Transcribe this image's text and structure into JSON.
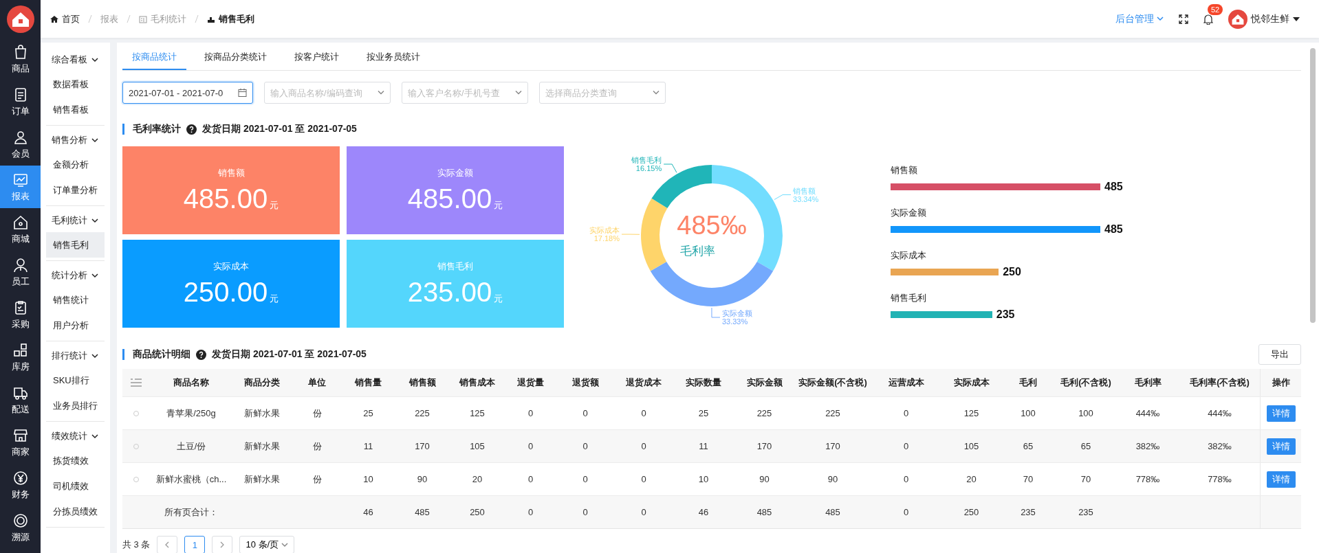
{
  "top_bar": {
    "breadcrumb": [
      {
        "label": "首页",
        "kind": "home"
      },
      {
        "label": "报表",
        "kind": "plain"
      },
      {
        "label": "毛利统计",
        "kind": "doc"
      },
      {
        "label": "销售毛利",
        "kind": "current"
      }
    ],
    "menu": "后台管理",
    "notifications": "52",
    "user": "悦邻生鲜"
  },
  "rail": [
    {
      "label": "商品",
      "selected": false
    },
    {
      "label": "订单",
      "selected": false
    },
    {
      "label": "会员",
      "selected": false
    },
    {
      "label": "报表",
      "selected": true
    },
    {
      "label": "商城",
      "selected": false
    },
    {
      "label": "员工",
      "selected": false
    },
    {
      "label": "采购",
      "selected": false
    },
    {
      "label": "库房",
      "selected": false
    },
    {
      "label": "配送",
      "selected": false
    },
    {
      "label": "商家",
      "selected": false
    },
    {
      "label": "财务",
      "selected": false
    },
    {
      "label": "溯源",
      "selected": false
    }
  ],
  "submenu": [
    {
      "label": "综合看板",
      "expanded": true,
      "items": [
        {
          "label": "数据看板",
          "selected": false
        },
        {
          "label": "销售看板",
          "selected": false
        }
      ]
    },
    {
      "label": "销售分析",
      "expanded": true,
      "items": [
        {
          "label": "金额分析",
          "selected": false
        },
        {
          "label": "订单量分析",
          "selected": false
        }
      ]
    },
    {
      "label": "毛利统计",
      "expanded": true,
      "items": [
        {
          "label": "销售毛利",
          "selected": true
        }
      ]
    },
    {
      "label": "统计分析",
      "expanded": true,
      "items": [
        {
          "label": "销售统计",
          "selected": false
        },
        {
          "label": "用户分析",
          "selected": false
        }
      ]
    },
    {
      "label": "排行统计",
      "expanded": true,
      "items": [
        {
          "label": "SKU排行",
          "selected": false
        },
        {
          "label": "业务员排行",
          "selected": false
        }
      ]
    },
    {
      "label": "绩效统计",
      "expanded": true,
      "items": [
        {
          "label": "拣货绩效",
          "selected": false
        },
        {
          "label": "司机绩效",
          "selected": false
        },
        {
          "label": "分拣员绩效",
          "selected": false
        }
      ]
    }
  ],
  "tabs": [
    {
      "label": "按商品统计",
      "selected": true
    },
    {
      "label": "按商品分类统计",
      "selected": false
    },
    {
      "label": "按客户统计",
      "selected": false
    },
    {
      "label": "按业务员统计",
      "selected": false
    }
  ],
  "filters": {
    "date_range": {
      "value": "2021-07-01 - 2021-07-0"
    },
    "selects": [
      {
        "placeholder": "输入商品名称/编码查询"
      },
      {
        "placeholder": "输入客户名称/手机号查"
      },
      {
        "placeholder": "选择商品分类查询"
      }
    ]
  },
  "summary": {
    "title": "毛利率统计",
    "subtitle": "发货日期 2021-07-01 至 2021-07-05",
    "cards": [
      {
        "label": "销售额",
        "value": "485.00",
        "unit": "元",
        "color": "#fd8367"
      },
      {
        "label": "实际金额",
        "value": "485.00",
        "unit": "元",
        "color": "#9d87fb"
      },
      {
        "label": "实际成本",
        "value": "250.00",
        "unit": "元",
        "color": "#0a9cff"
      },
      {
        "label": "销售毛利",
        "value": "235.00",
        "unit": "元",
        "color": "#54d6fc"
      }
    ],
    "center_value": "485‰",
    "center_label": "毛利率",
    "donut": {
      "chart_data": {
        "type": "donut",
        "categories": [
          "销售额",
          "实际金额",
          "实际成本",
          "销售毛利"
        ],
        "values": [
          33.34,
          33.33,
          17.18,
          16.15
        ],
        "colors": [
          "#72ddfe",
          "#74a9fd",
          "#fed46a",
          "#20b5b8"
        ],
        "annotations": [
          {
            "text": "33.34%"
          },
          {
            "text": "33.33%"
          },
          {
            "text": "17.18%"
          },
          {
            "text": "16.15%"
          }
        ]
      }
    },
    "bars": {
      "chart_data": {
        "type": "bar",
        "orientation": "horizontal",
        "categories": [
          "销售额",
          "实际金额",
          "实际成本",
          "销售毛利"
        ],
        "values": [
          485,
          485,
          250,
          235
        ],
        "colors": [
          "#d64f66",
          "#1296fb",
          "#e9a552",
          "#21b3b4"
        ],
        "data_labels": true
      }
    }
  },
  "detail": {
    "title": "商品统计明细",
    "subtitle": "发货日期 2021-07-01 至 2021-07-05",
    "export_button": "导出",
    "columns": [
      "商品名称",
      "商品分类",
      "单位",
      "销售量",
      "销售额",
      "销售成本",
      "退货量",
      "退货额",
      "退货成本",
      "实际数量",
      "实际金额",
      "实际金额(不含税)",
      "运营成本",
      "实际成本",
      "毛利",
      "毛利(不含税)",
      "毛利率",
      "毛利率(不含税)",
      "操作"
    ],
    "rows": [
      {
        "selected": false,
        "cells": [
          "青苹果/250g",
          "新鲜水果",
          "份",
          "25",
          "225",
          "125",
          "0",
          "0",
          "0",
          "25",
          "225",
          "225",
          "0",
          "125",
          "100",
          "100",
          "444‰",
          "444‰"
        ],
        "action": "详情"
      },
      {
        "selected": false,
        "cells": [
          "土豆/份",
          "新鲜水果",
          "份",
          "11",
          "170",
          "105",
          "0",
          "0",
          "0",
          "11",
          "170",
          "170",
          "0",
          "105",
          "65",
          "65",
          "382‰",
          "382‰"
        ],
        "action": "详情"
      },
      {
        "selected": false,
        "cells": [
          "新鲜水蜜桃（ch...",
          "新鲜水果",
          "份",
          "10",
          "90",
          "20",
          "0",
          "0",
          "0",
          "10",
          "90",
          "90",
          "0",
          "20",
          "70",
          "70",
          "778‰",
          "778‰"
        ],
        "action": "详情"
      }
    ],
    "total": {
      "label": "所有页合计：",
      "cells": [
        "46",
        "485",
        "250",
        "0",
        "0",
        "0",
        "46",
        "485",
        "485",
        "0",
        "250",
        "235",
        "235"
      ]
    }
  },
  "pagination": {
    "total": "共 3 条",
    "pages": [
      {
        "label": "1",
        "selected": true
      }
    ],
    "page_size": "10 条/页"
  }
}
